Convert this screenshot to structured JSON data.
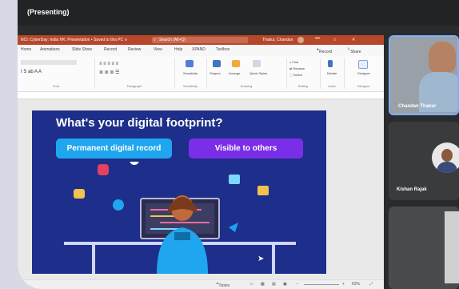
{
  "window": {
    "title": "(Presenting)"
  },
  "powerpoint": {
    "file_title": "NCI: CyberDay: India HK: Presentation • Saved to this PC ∨",
    "search_placeholder": "Search (Alt+Q)",
    "user_name": "Thakur, Chandan",
    "menu": [
      "Home",
      "Animations",
      "Slide Show",
      "Record",
      "Review",
      "View",
      "Help",
      "XPAND",
      "Toolbox"
    ],
    "record_label": "Record",
    "share_label": "Share",
    "ribbon_groups": [
      "Font",
      "Paragraph",
      "Sensitivity",
      "Drawing",
      "Editing",
      "Voice",
      "Designer"
    ],
    "ribbon_buttons": {
      "sensitivity": "Sensitivity",
      "shapes": "Shapes",
      "arrange": "Arrange",
      "quick_styles": "Quick Styles",
      "find": "Find",
      "replace": "Replace",
      "select": "Select",
      "dictate": "Dictate",
      "designer": "Designer"
    },
    "slide": {
      "title": "What's your digital footprint?",
      "pill_left": "Permanent digital record",
      "pill_right": "Visible to others"
    },
    "status": {
      "notes": "Notes",
      "zoom": "63%"
    }
  },
  "participants": [
    {
      "name": "Chandan Thakur"
    },
    {
      "name": "Kishan Rajak"
    }
  ],
  "colors": {
    "ppt_red": "#b7472a",
    "slide_bg": "#1d2f8a",
    "pill_blue": "#1fa6ee",
    "pill_purple": "#7b2ee8",
    "speaker_border": "#7db0ff"
  }
}
